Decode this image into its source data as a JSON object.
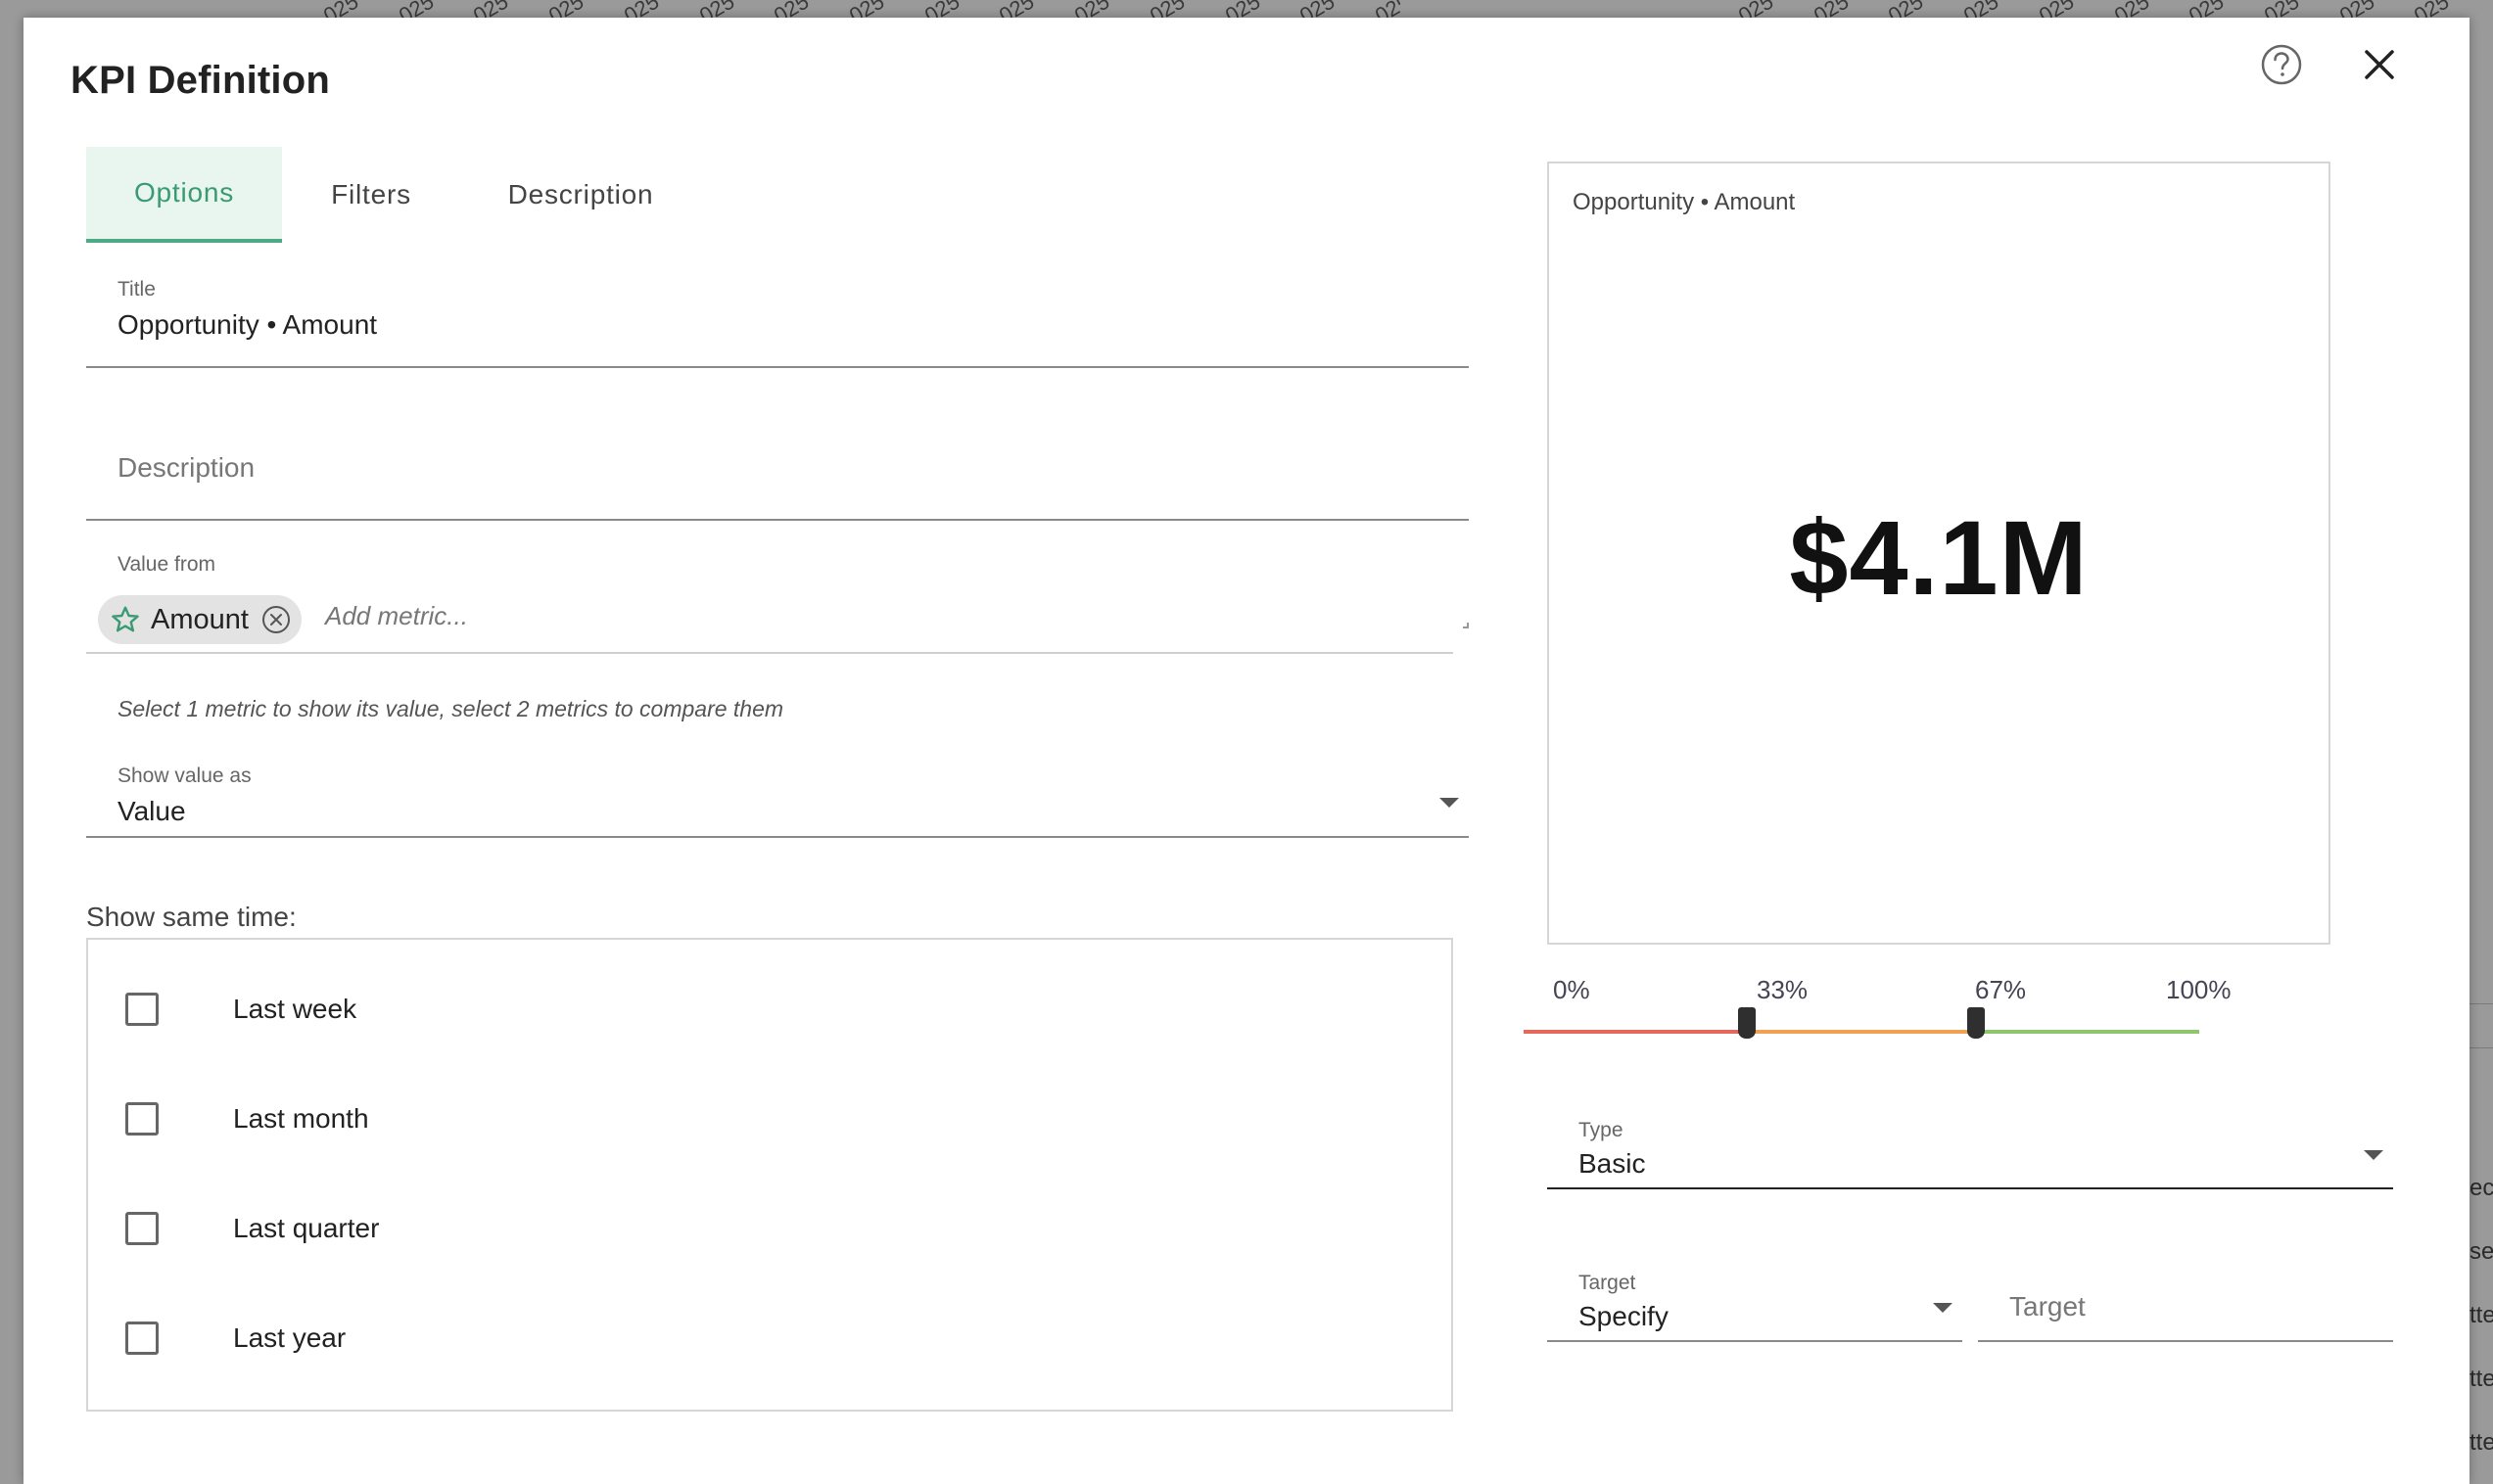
{
  "background": {
    "strip_text": "025",
    "right_edge_texts": [
      "eca",
      "sed",
      "tte",
      "tte",
      "tte"
    ]
  },
  "dialog": {
    "title": "KPI Definition",
    "help_icon": "help-circle-icon",
    "close_icon": "close-icon"
  },
  "tabs": [
    {
      "label": "Options",
      "active": true
    },
    {
      "label": "Filters",
      "active": false
    },
    {
      "label": "Description",
      "active": false
    }
  ],
  "form": {
    "title_label": "Title",
    "title_value": "Opportunity • Amount",
    "description_placeholder": "Description",
    "value_from_label": "Value from",
    "metric_chip": {
      "label": "Amount",
      "icon": "star-outline-icon",
      "remove_icon": "remove-circle-icon"
    },
    "add_metric_placeholder": "Add metric...",
    "hint": "Select 1 metric to show its value, select 2 metrics to compare them",
    "show_value_as_label": "Show value as",
    "show_value_as_value": "Value",
    "show_same_time_title": "Show same time:",
    "time_options": [
      {
        "label": "Last week",
        "checked": false
      },
      {
        "label": "Last month",
        "checked": false
      },
      {
        "label": "Last quarter",
        "checked": false
      },
      {
        "label": "Last year",
        "checked": false
      }
    ]
  },
  "preview": {
    "title": "Opportunity • Amount",
    "value": "$4.1M"
  },
  "thresholds": {
    "labels": [
      "0%",
      "33%",
      "67%",
      "100%"
    ],
    "handles": [
      0.33,
      0.67
    ],
    "colors": {
      "low": "#e4685c",
      "mid": "#f0a152",
      "high": "#8fc56b"
    }
  },
  "type_field": {
    "label": "Type",
    "value": "Basic"
  },
  "target_select": {
    "label": "Target",
    "value": "Specify"
  },
  "target_input": {
    "placeholder": "Target"
  },
  "colors": {
    "accent": "#3a9a73",
    "accent_bg": "#e9f5ef"
  }
}
